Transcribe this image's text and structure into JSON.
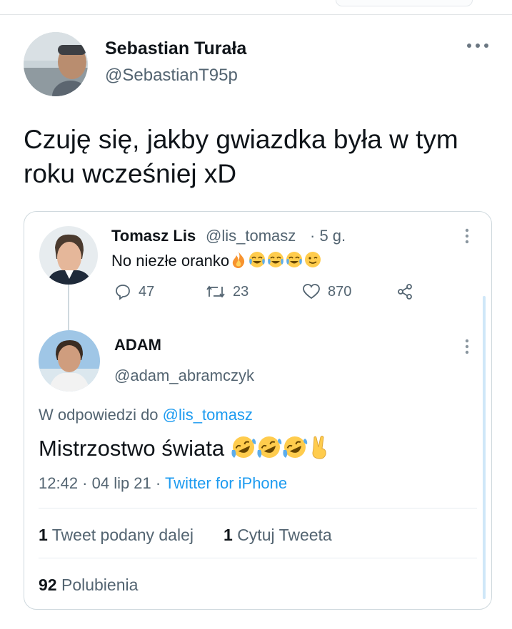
{
  "tweet": {
    "author_name": "Sebastian Turała",
    "author_handle": "@SebastianT95p",
    "text": "Czuję się, jakby gwiazdka była w tym roku wcześniej xD"
  },
  "quoted_tweet": {
    "author_name": "Tomasz Lis",
    "author_handle": "@lis_tomasz",
    "time_ago": "· 5 g.",
    "text": "No niezłe oranko",
    "emojis": [
      "fire-emoji",
      "joy-emoji",
      "joy-emoji",
      "joy-emoji",
      "wink-emoji"
    ],
    "replies": "47",
    "retweets": "23",
    "likes": "870"
  },
  "reply_tweet": {
    "author_name": "ADAM",
    "author_handle": "@adam_abramczyk",
    "reply_prefix": "W odpowiedzi do",
    "reply_to": "@lis_tomasz",
    "text": "Mistrzostwo świata",
    "emojis": [
      "rofl-emoji",
      "rofl-emoji",
      "rofl-emoji",
      "victory-hand-emoji"
    ],
    "time": "12:42 · 04 lip 21 ·",
    "source": "Twitter for iPhone",
    "retweets_count": "1",
    "retweets_label": "Tweet podany dalej",
    "quotes_count": "1",
    "quotes_label": "Cytuj Tweeta",
    "likes_count": "92",
    "likes_label": "Polubienia"
  },
  "colors": {
    "link": "#1d9bf0",
    "muted": "#536471",
    "text": "#0f1419"
  }
}
